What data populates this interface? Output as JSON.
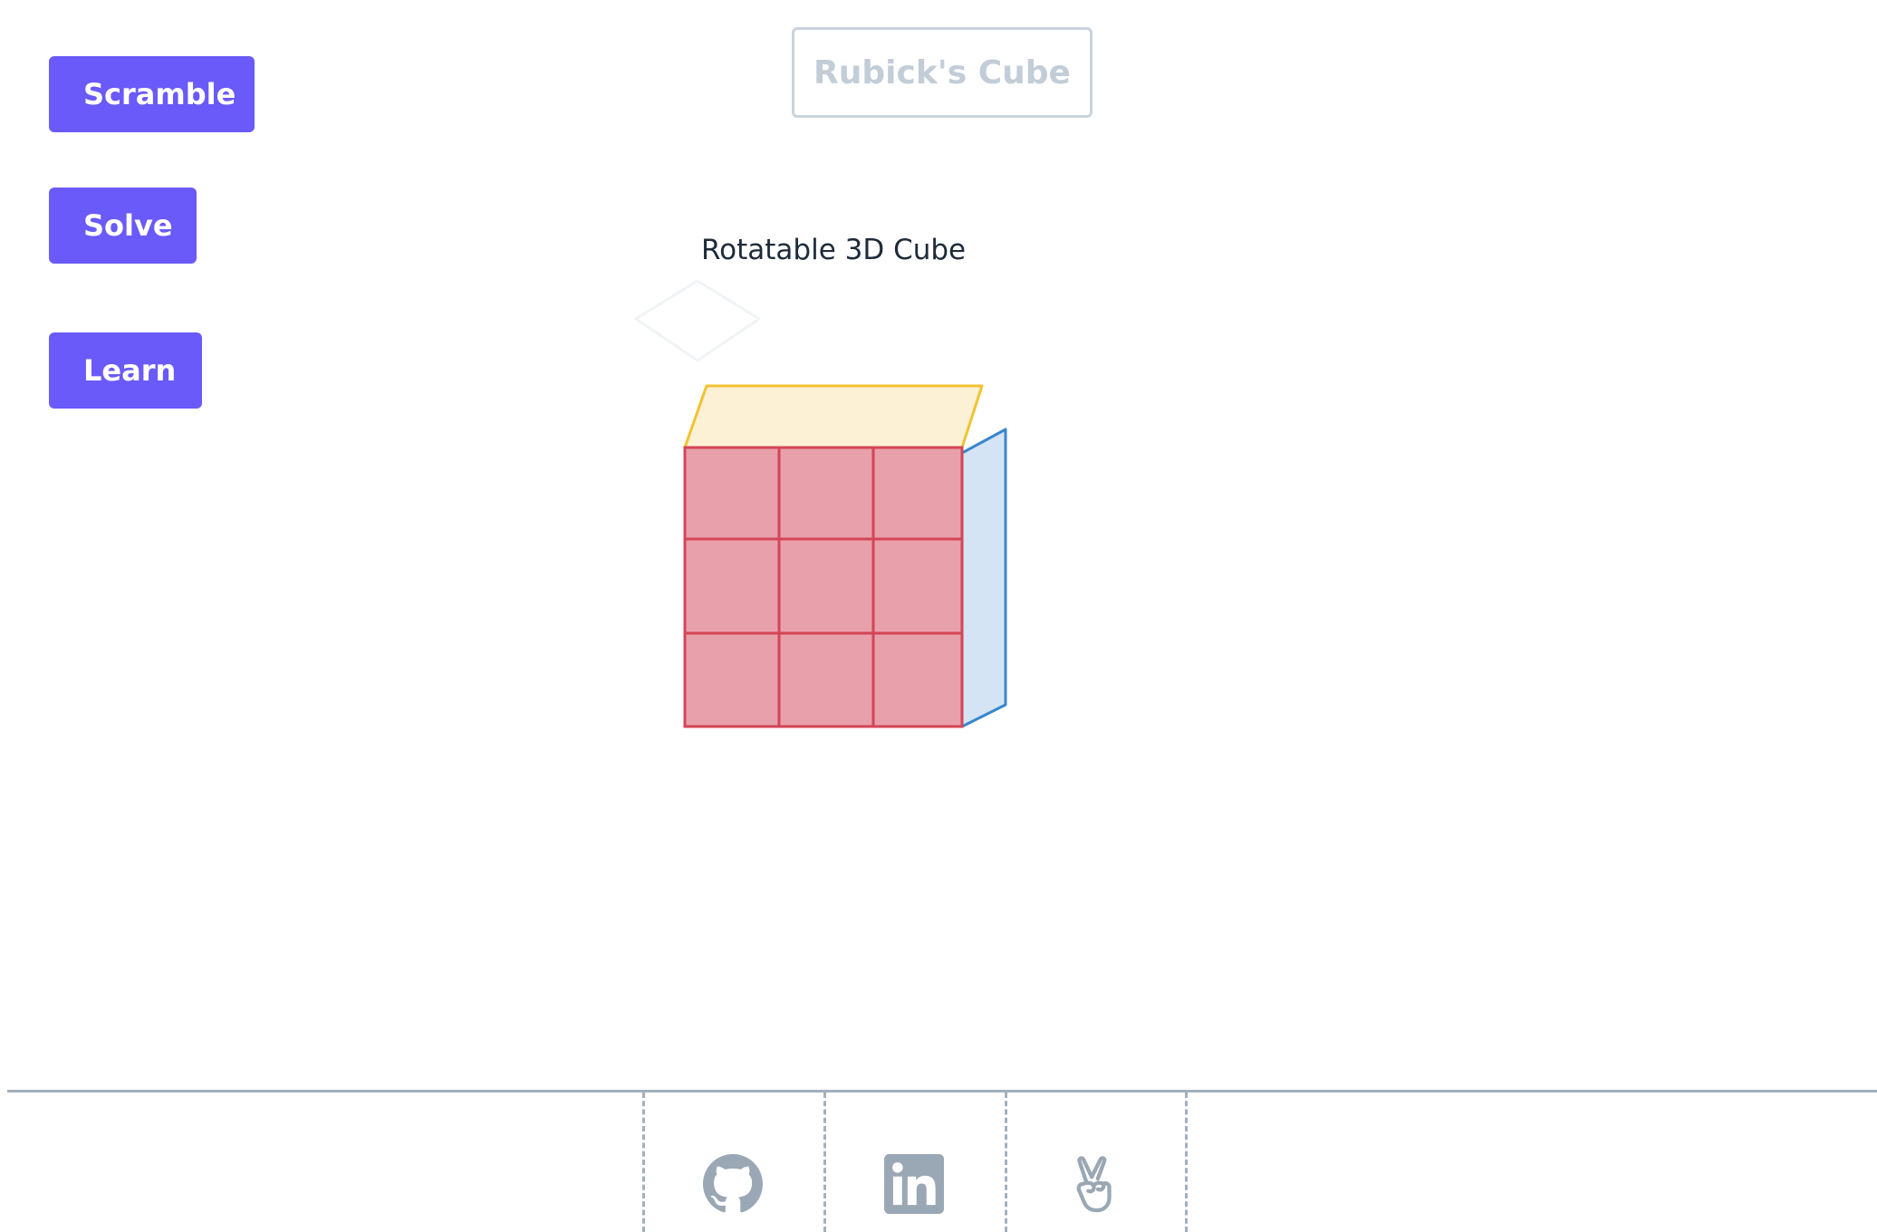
{
  "sidebar": {
    "buttons": {
      "scramble": "Scramble",
      "solve": "Solve",
      "learn": "Learn"
    }
  },
  "header": {
    "title": "Rubick's Cube"
  },
  "main": {
    "subtitle": "Rotatable 3D Cube",
    "cube": {
      "front_color": "#e8a0aa",
      "front_stroke": "#d44558",
      "top_color": "#fcf1d5",
      "top_stroke": "#f2c232",
      "side_color": "#d4e4f5",
      "side_stroke": "#3a86cf"
    }
  },
  "footer": {
    "links": [
      {
        "icon": "github-icon"
      },
      {
        "icon": "linkedin-icon"
      },
      {
        "icon": "peace-hand-icon"
      }
    ]
  },
  "colors": {
    "accent": "#6a5af9",
    "muted": "#a3b0bd"
  }
}
